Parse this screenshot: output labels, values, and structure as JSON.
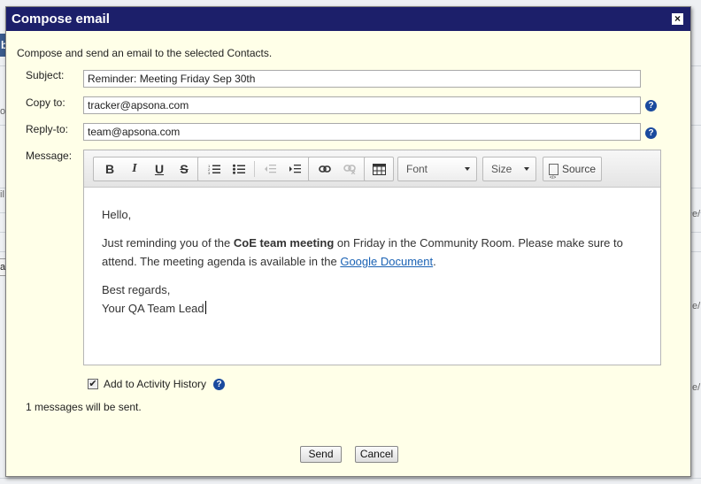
{
  "dialog": {
    "title": "Compose email",
    "close_glyph": "×",
    "intro": "Compose and send an email to the selected Contacts."
  },
  "form": {
    "subject_label": "Subject:",
    "subject_value": "Reminder: Meeting Friday Sep 30th",
    "copy_to_label": "Copy to:",
    "copy_to_value": "tracker@apsona.com",
    "reply_to_label": "Reply-to:",
    "reply_to_value": "team@apsona.com",
    "message_label": "Message:"
  },
  "toolbar": {
    "bold": "B",
    "italic": "I",
    "underline": "U",
    "strike": "S",
    "font_label": "Font",
    "size_label": "Size",
    "source_label": "Source",
    "icons": [
      "bold-icon",
      "italic-icon",
      "underline-icon",
      "strikethrough-icon",
      "numbered-list-icon",
      "bulleted-list-icon",
      "outdent-icon",
      "indent-icon",
      "link-icon",
      "unlink-icon",
      "table-icon",
      "source-icon"
    ]
  },
  "message": {
    "greeting": "Hello,",
    "line1_before": "Just reminding you of the ",
    "line1_bold": "CoE team meeting",
    "line1_after": " on Friday in the Community Room. Please make sure to attend. The meeting agenda is available in the ",
    "link_text": "Google Document",
    "line1_end": ".",
    "closing": "Best regards,",
    "signature": "Your QA Team Lead"
  },
  "options": {
    "activity_label": "Add to Activity History",
    "activity_checked": true,
    "sent_count_text": "1 messages will be sent."
  },
  "buttons": {
    "send": "Send",
    "cancel": "Cancel"
  },
  "background": {
    "tab_letter": "b",
    "edge_texts": [
      "oc",
      "il",
      "ac",
      "e/",
      "e/",
      "e/"
    ]
  },
  "colors": {
    "titlebar": "#1c1f6a",
    "dialog_bg": "#ffffe8",
    "link": "#1a62b4",
    "help": "#1a4a9e"
  }
}
